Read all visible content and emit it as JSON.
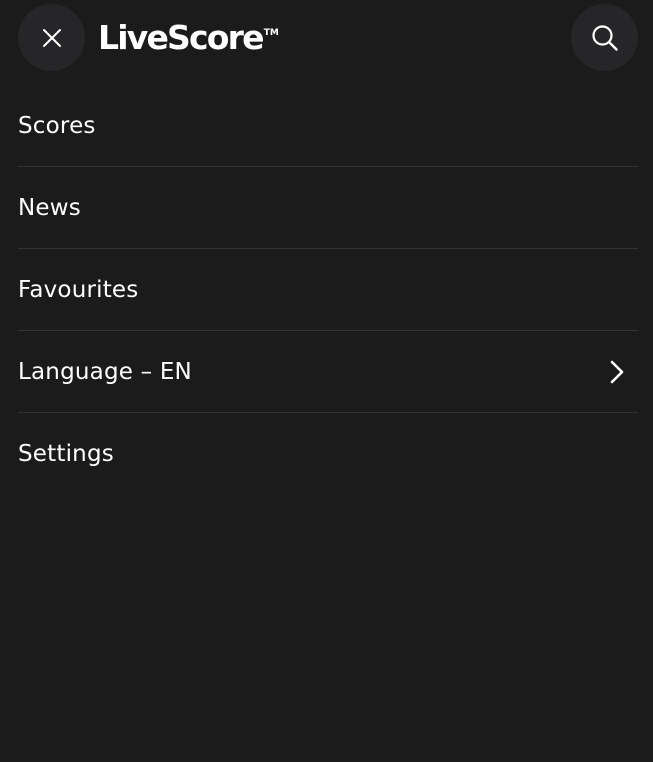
{
  "header": {
    "logo_text": "LiveScore",
    "logo_tm": "TM"
  },
  "menu": {
    "items": [
      {
        "label": "Scores"
      },
      {
        "label": "News"
      },
      {
        "label": "Favourites"
      },
      {
        "label": "Language – EN"
      },
      {
        "label": "Settings"
      }
    ]
  },
  "icons": {
    "close": "close-icon",
    "search": "search-icon",
    "chevron": "chevron-right-icon"
  },
  "colors": {
    "background": "#1b1b1c",
    "button_bg": "#262628",
    "divider": "#333335",
    "text": "#ffffff"
  }
}
